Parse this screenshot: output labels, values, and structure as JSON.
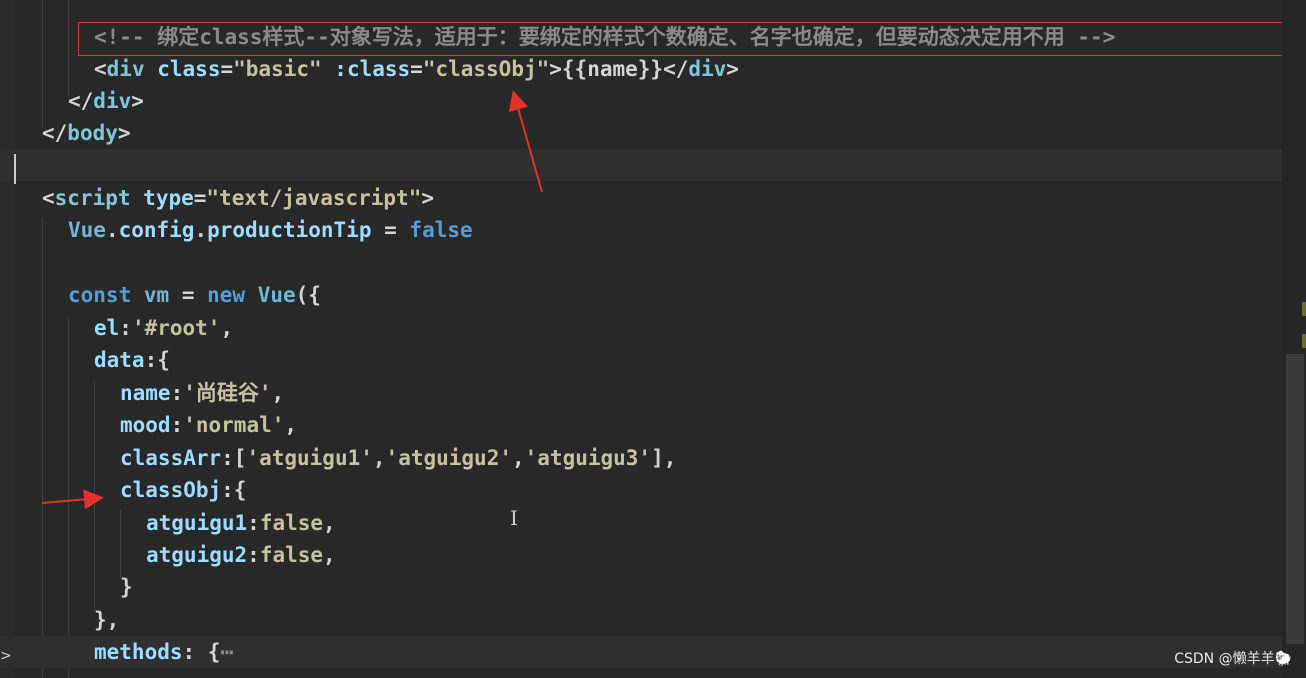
{
  "code_lines": [
    {
      "tokens": [
        [
          "tok-cmt",
          "<!-- 绑定class样式--对象写法，适用于：要绑定的样式个数确定、名字也确定，但要动态决定用不用 -->"
        ]
      ]
    },
    {
      "tokens": [
        [
          "tok-pun",
          "<"
        ],
        [
          "tok-tag",
          "div"
        ],
        [
          "tok-txt",
          " "
        ],
        [
          "tok-attr",
          "class"
        ],
        [
          "tok-pun",
          "="
        ],
        [
          "tok-strg",
          "\"basic\""
        ],
        [
          "tok-txt",
          " "
        ],
        [
          "tok-attr",
          ":class"
        ],
        [
          "tok-pun",
          "="
        ],
        [
          "tok-strg",
          "\"classObj\""
        ],
        [
          "tok-pun",
          ">"
        ],
        [
          "tok-txt",
          "{{name}}"
        ],
        [
          "tok-pun",
          "</"
        ],
        [
          "tok-tag",
          "div"
        ],
        [
          "tok-pun",
          ">"
        ]
      ]
    },
    {
      "tokens": [
        [
          "tok-pun",
          "</"
        ],
        [
          "tok-tag",
          "div"
        ],
        [
          "tok-pun",
          ">"
        ]
      ]
    },
    {
      "tokens": [
        [
          "tok-pun",
          "</"
        ],
        [
          "tok-tag",
          "body"
        ],
        [
          "tok-pun",
          ">"
        ]
      ]
    },
    {
      "tokens": []
    },
    {
      "tokens": [
        [
          "tok-pun",
          "<"
        ],
        [
          "tok-tag",
          "script"
        ],
        [
          "tok-txt",
          " "
        ],
        [
          "tok-attr",
          "type"
        ],
        [
          "tok-pun",
          "="
        ],
        [
          "tok-strg",
          "\"text/javascript\""
        ],
        [
          "tok-pun",
          ">"
        ]
      ]
    },
    {
      "tokens": [
        [
          "tok-var",
          "Vue"
        ],
        [
          "tok-pun",
          "."
        ],
        [
          "tok-prop",
          "config"
        ],
        [
          "tok-pun",
          "."
        ],
        [
          "tok-prop",
          "productionTip"
        ],
        [
          "tok-txt",
          " = "
        ],
        [
          "tok-kw",
          "false"
        ]
      ]
    },
    {
      "tokens": []
    },
    {
      "tokens": [
        [
          "tok-kw",
          "const"
        ],
        [
          "tok-txt",
          " "
        ],
        [
          "tok-var",
          "vm"
        ],
        [
          "tok-txt",
          " = "
        ],
        [
          "tok-kw",
          "new"
        ],
        [
          "tok-txt",
          " "
        ],
        [
          "tok-fn",
          "Vue"
        ],
        [
          "tok-pun",
          "({"
        ]
      ]
    },
    {
      "tokens": [
        [
          "tok-key",
          "el"
        ],
        [
          "tok-pun",
          ":"
        ],
        [
          "tok-strg",
          "'#root'"
        ],
        [
          "tok-pun",
          ","
        ]
      ]
    },
    {
      "tokens": [
        [
          "tok-key",
          "data"
        ],
        [
          "tok-pun",
          ":{"
        ]
      ]
    },
    {
      "tokens": [
        [
          "tok-key",
          "name"
        ],
        [
          "tok-pun",
          ":"
        ],
        [
          "tok-strg",
          "'尚硅谷'"
        ],
        [
          "tok-pun",
          ","
        ]
      ]
    },
    {
      "tokens": [
        [
          "tok-key",
          "mood"
        ],
        [
          "tok-pun",
          ":"
        ],
        [
          "tok-strg",
          "'normal'"
        ],
        [
          "tok-pun",
          ","
        ]
      ]
    },
    {
      "tokens": [
        [
          "tok-key",
          "classArr"
        ],
        [
          "tok-pun",
          ":["
        ],
        [
          "tok-strg",
          "'atguigu1'"
        ],
        [
          "tok-pun",
          ","
        ],
        [
          "tok-strg",
          "'atguigu2'"
        ],
        [
          "tok-pun",
          ","
        ],
        [
          "tok-strg",
          "'atguigu3'"
        ],
        [
          "tok-pun",
          "],"
        ]
      ]
    },
    {
      "tokens": [
        [
          "tok-key",
          "classObj"
        ],
        [
          "tok-pun",
          ":{"
        ]
      ]
    },
    {
      "tokens": [
        [
          "tok-key",
          "atguigu1"
        ],
        [
          "tok-pun",
          ":"
        ],
        [
          "tok-bool",
          "false"
        ],
        [
          "tok-pun",
          ","
        ]
      ]
    },
    {
      "tokens": [
        [
          "tok-key",
          "atguigu2"
        ],
        [
          "tok-pun",
          ":"
        ],
        [
          "tok-bool",
          "false"
        ],
        [
          "tok-pun",
          ","
        ]
      ]
    },
    {
      "tokens": [
        [
          "tok-pun",
          "}"
        ]
      ]
    },
    {
      "tokens": [
        [
          "tok-pun",
          "},"
        ]
      ]
    },
    {
      "tokens": [
        [
          "tok-key",
          "methods"
        ],
        [
          "tok-pun",
          ": {"
        ],
        [
          "tok-cmt",
          "⋯"
        ]
      ]
    }
  ],
  "watermark": "CSDN @懒羊羊🐑",
  "text_cursor_glyph": "I",
  "fold_glyph": ">",
  "annotation_color": "#e3322b"
}
